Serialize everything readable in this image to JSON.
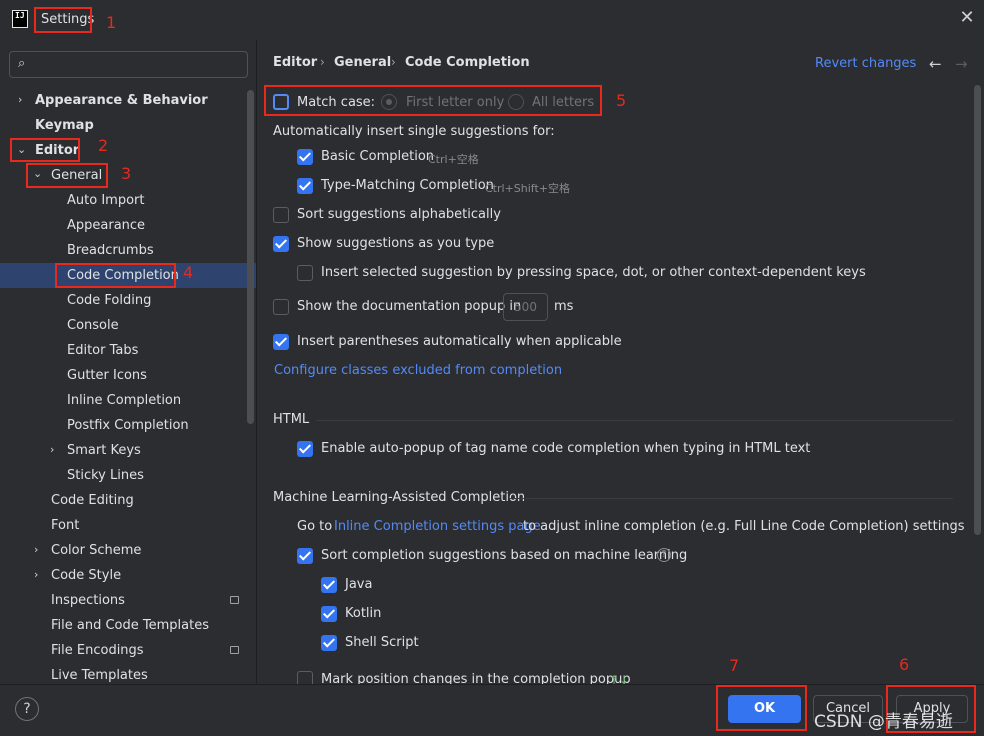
{
  "window": {
    "title": "Settings",
    "app_logo_text": "IJ",
    "close_glyph": "✕"
  },
  "search": {
    "placeholder": "",
    "icon": "search-icon"
  },
  "sidebar": {
    "items": [
      {
        "label": "Appearance & Behavior",
        "bold": true
      },
      {
        "label": "Keymap",
        "bold": true
      },
      {
        "label": "Editor",
        "bold": true
      },
      {
        "label": "General"
      },
      {
        "label": "Auto Import"
      },
      {
        "label": "Appearance"
      },
      {
        "label": "Breadcrumbs"
      },
      {
        "label": "Code Completion",
        "selected": true
      },
      {
        "label": "Code Folding"
      },
      {
        "label": "Console"
      },
      {
        "label": "Editor Tabs"
      },
      {
        "label": "Gutter Icons"
      },
      {
        "label": "Inline Completion"
      },
      {
        "label": "Postfix Completion"
      },
      {
        "label": "Smart Keys"
      },
      {
        "label": "Sticky Lines"
      },
      {
        "label": "Code Editing"
      },
      {
        "label": "Font"
      },
      {
        "label": "Color Scheme"
      },
      {
        "label": "Code Style"
      },
      {
        "label": "Inspections"
      },
      {
        "label": "File and Code Templates"
      },
      {
        "label": "File Encodings"
      },
      {
        "label": "Live Templates"
      }
    ]
  },
  "breadcrumb": [
    "Editor",
    "General",
    "Code Completion"
  ],
  "header": {
    "revert": "Revert changes",
    "back_glyph": "←",
    "forward_glyph": "→"
  },
  "options": {
    "match_case": "Match case:",
    "first_letter_only": "First letter only",
    "all_letters": "All letters",
    "auto_insert_heading": "Automatically insert single suggestions for:",
    "basic_completion": "Basic Completion",
    "basic_shortcut": "Ctrl+空格",
    "type_matching": "Type-Matching Completion",
    "type_matching_shortcut": "Ctrl+Shift+空格",
    "sort_alpha": "Sort suggestions alphabetically",
    "show_as_type": "Show suggestions as you type",
    "insert_selected": "Insert selected suggestion by pressing space, dot, or other context-dependent keys",
    "doc_popup": "Show the documentation popup in",
    "doc_popup_value": "500",
    "doc_popup_unit": "ms",
    "insert_parens": "Insert parentheses automatically when applicable",
    "configure_link": "Configure classes excluded from completion"
  },
  "html_section": {
    "title": "HTML",
    "auto_popup": "Enable auto-popup of tag name code completion when typing in HTML text"
  },
  "ml_section": {
    "title": "Machine Learning-Assisted Completion",
    "goto_prefix": "Go to",
    "goto_link": "Inline Completion settings page",
    "goto_suffix": "to adjust inline completion (e.g. Full Line Code Completion) settings",
    "sort_ml": "Sort completion suggestions based on machine learning",
    "help_glyph": "?",
    "java": "Java",
    "kotlin": "Kotlin",
    "shell": "Shell Script",
    "mark_position": "Mark position changes in the completion popup",
    "mark_glyph": "↑↓"
  },
  "footer": {
    "help_glyph": "?",
    "ok": "OK",
    "cancel": "Cancel",
    "apply": "Apply"
  },
  "annotations": [
    "1",
    "2",
    "3",
    "4",
    "5",
    "6",
    "7"
  ],
  "watermark": "CSDN @青春易逝",
  "colors": {
    "background": "#2b2d30",
    "accent": "#3574f0",
    "link": "#548af7",
    "selection": "#2e436e",
    "annotation": "#e8291c"
  }
}
